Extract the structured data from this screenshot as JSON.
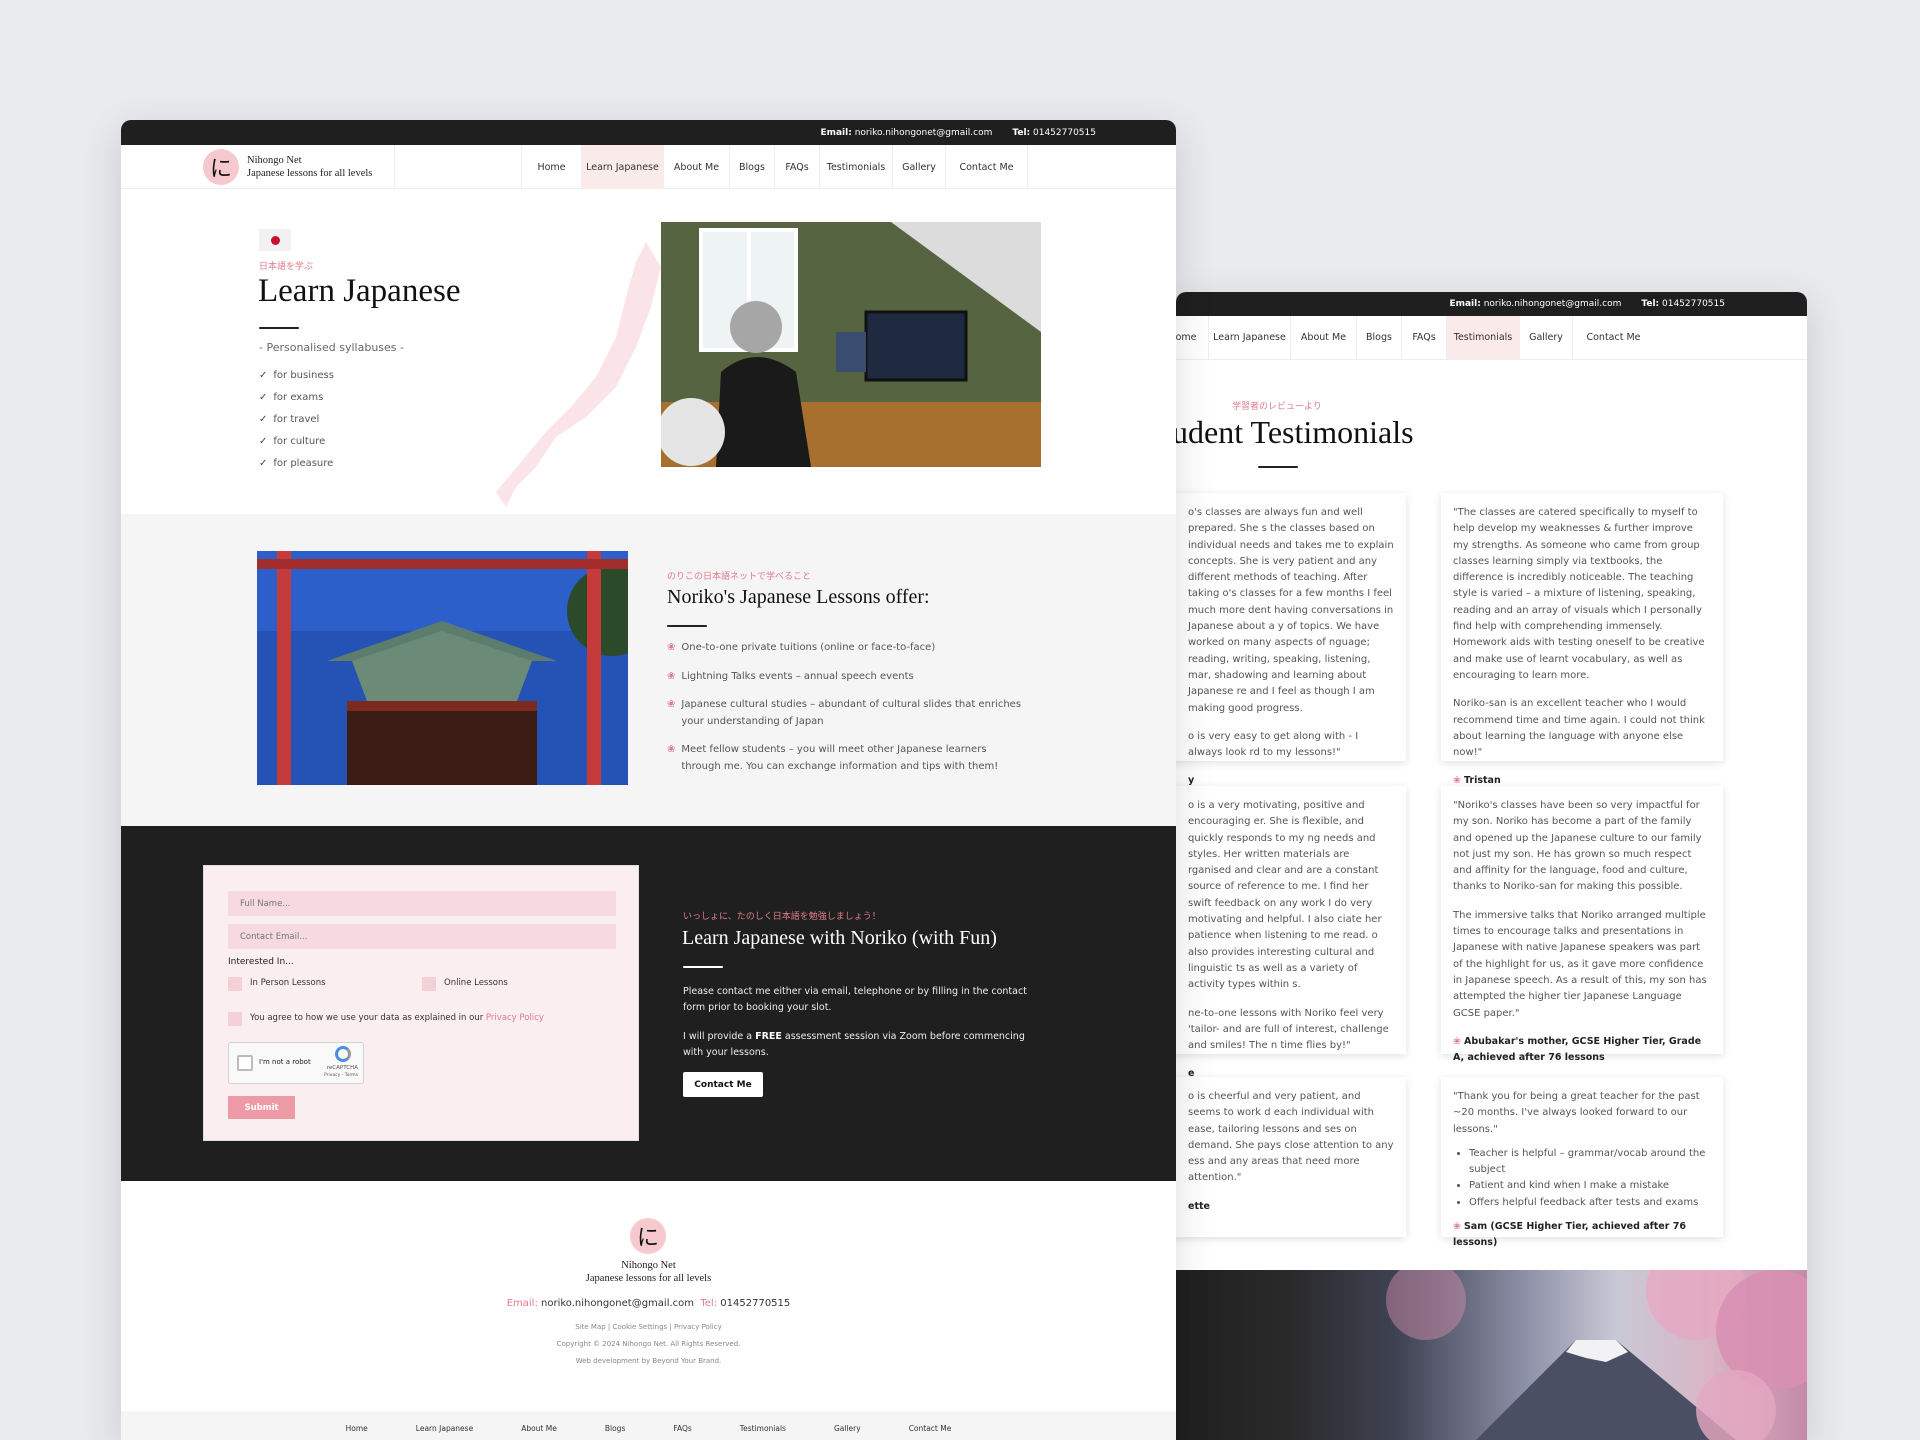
{
  "contact": {
    "email_label": "Email:",
    "email": "noriko.nihongonet@gmail.com",
    "tel_label": "Tel:",
    "tel": "01452770515"
  },
  "brand": {
    "name": "Nihongo Net",
    "tagline": "Japanese lessons for all levels",
    "logo_char": "に"
  },
  "nav": [
    "Home",
    "Learn Japanese",
    "About Me",
    "Blogs",
    "FAQs",
    "Testimonials",
    "Gallery",
    "Contact Me"
  ],
  "hero": {
    "jp": "日本語を学ぶ",
    "title": "Learn Japanese",
    "subtitle": "- Personalised syllabuses -",
    "list": [
      "for business",
      "for exams",
      "for travel",
      "for culture",
      "for pleasure"
    ]
  },
  "offer": {
    "jp": "のりこの日本語ネットで学べること",
    "title": "Noriko's Japanese Lessons offer:",
    "items": [
      "One-to-one private tuitions (online or face-to-face)",
      "Lightning Talks events – annual speech events",
      "Japanese cultural studies – abundant of cultural slides that enriches your understanding of Japan",
      "Meet fellow students – you will meet other Japanese learners through me. You can exchange information and tips with them!"
    ]
  },
  "form": {
    "name_placeholder": "Full Name...",
    "email_placeholder": "Contact Email...",
    "interested_label": "Interested In...",
    "opt1": "In Person Lessons",
    "opt2": "Online Lessons",
    "consent": "You agree to how we use your data as explained in our",
    "privacy_link": "Privacy Policy",
    "captcha_label": "I'm not a robot",
    "captcha_brand": "reCAPTCHA",
    "captcha_terms": "Privacy - Terms",
    "submit": "Submit"
  },
  "cta": {
    "jp": "いっしょに、たのしく日本語を勉強しましょう！",
    "title": "Learn Japanese with Noriko (with Fun)",
    "p1": "Please contact me either via email, telephone or by filling in the contact form prior to booking your slot.",
    "p2_before": "I will provide a",
    "p2_bold": "FREE",
    "p2_after": "assessment session via Zoom before commencing with your lessons.",
    "button": "Contact Me"
  },
  "footer": {
    "links": [
      "Site Map",
      "Cookie Settings",
      "Privacy Policy"
    ],
    "copyright": "Copyright © 2024 Nihongo Net. All Rights Reserved.",
    "credit": "Web development by Beyond Your Brand."
  },
  "testimonials": {
    "jp": "学習者のレビューより",
    "title": "udent Testimonials",
    "cards": [
      {
        "paras": [
          "o's classes are always fun and well prepared. She s the classes based on individual needs and takes me to explain concepts. She is very patient and any different methods of teaching. After taking o's classes for a few months I feel much more dent having conversations in Japanese about a y of topics. We have worked on many aspects of nguage; reading, writing, speaking, listening, mar, shadowing and learning about Japanese re and I feel as though I am making good progress.",
          "o is very easy to get along with - I always look rd to my lessons!\""
        ],
        "author": "y"
      },
      {
        "paras": [
          "\"The classes are catered specifically to myself to help develop my weaknesses & further improve my strengths. As someone who came from group classes learning simply via textbooks, the difference is incredibly noticeable. The teaching style is varied – a mixture of listening, speaking, reading and an array of visuals which I personally find help with comprehending immensely. Homework aids with testing oneself to be creative and make use of learnt vocabulary, as well as encouraging to learn more.",
          "Noriko-san is an excellent teacher who I would recommend time and time again. I could not think about learning the language with anyone else now!\""
        ],
        "author": "Tristan"
      },
      {
        "paras": [
          "o is a very motivating, positive and encouraging er. She is flexible, and quickly responds to my ng needs and styles. Her written materials are rganised and clear and are a constant source of reference to me. I find her swift feedback on any work I do very motivating and helpful. I also ciate her patience when listening to me read. o also provides interesting cultural and linguistic ts as well as a variety of activity types within s.",
          "ne-to-one lessons with Noriko feel very 'tailor- and are full of interest, challenge and smiles! The n time flies by!\""
        ],
        "author": "e"
      },
      {
        "paras": [
          "\"Noriko's classes have been so very impactful for my son. Noriko has become a part of the family and opened up the Japanese culture to our family not just my son. He has grown so much respect and affinity for the language, food and culture, thanks to Noriko-san for making this possible.",
          "The immersive talks that Noriko arranged multiple times to encourage talks and presentations in Japanese with native Japanese speakers was part of the highlight for us, as it gave more confidence in Japanese speech. As a result of this, my son has attempted the higher tier Japanese Language GCSE paper.\""
        ],
        "author": "Abubakar's mother, GCSE Higher Tier, Grade A, achieved after 76 lessons"
      },
      {
        "paras": [
          "o is cheerful and very patient, and seems to work d each individual with ease, tailoring lessons and ses on demand. She pays close attention to any ess and any areas that need more attention.\""
        ],
        "author": "ette"
      },
      {
        "paras": [
          "\"Thank you for being a great teacher for the past ~20 months. I've always looked forward to our lessons.\""
        ],
        "bullets": [
          "Teacher is helpful – grammar/vocab around the subject",
          "Patient and kind when I make a mistake",
          "Offers helpful feedback after tests and exams"
        ],
        "author": "Sam (GCSE Higher Tier, achieved after 76 lessons)"
      }
    ]
  },
  "colors": {
    "accent": "#e07b8b",
    "dark": "#1f1f1f",
    "pink_bg": "#fbeaea"
  }
}
